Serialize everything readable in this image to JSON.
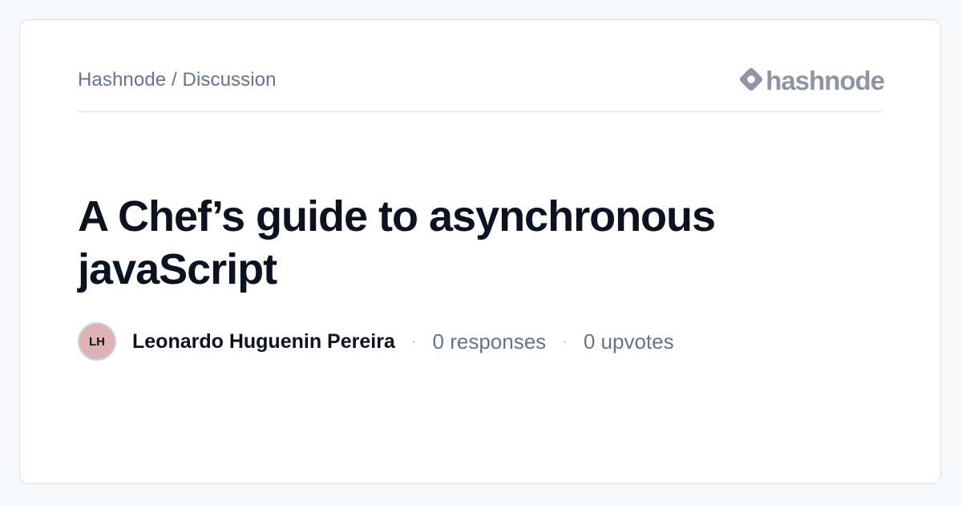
{
  "breadcrumb": "Hashnode / Discussion",
  "logo": {
    "text": "hashnode",
    "icon": "hashnode-logo-icon"
  },
  "post": {
    "title": "A Chef’s guide to asynchronous javaScript",
    "author": {
      "initials": "LH",
      "name": "Leonardo Huguenin Pereira"
    },
    "separator": "·",
    "responses": "0 responses",
    "upvotes": "0 upvotes"
  },
  "colors": {
    "background": "#f8f9fb",
    "card": "#ffffff",
    "title": "#0b1220",
    "muted": "#64748b",
    "logo": "#8d96a2",
    "avatar": "#ddb3b7"
  }
}
